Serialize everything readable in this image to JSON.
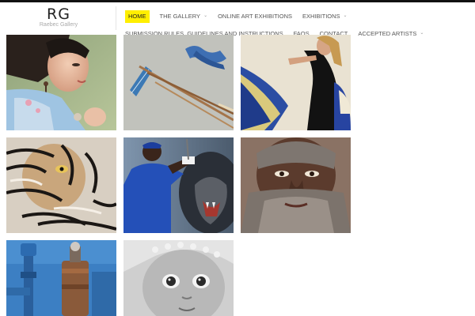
{
  "logo": {
    "mark": "RG",
    "subtitle": "Raebec Gallery"
  },
  "nav": {
    "row1": [
      {
        "label": "HOME",
        "active": true,
        "dropdown": false
      },
      {
        "label": "THE GALLERY",
        "active": false,
        "dropdown": true
      },
      {
        "label": "ONLINE ART EXHIBITIONS",
        "active": false,
        "dropdown": false
      },
      {
        "label": "EXHIBITIONS",
        "active": false,
        "dropdown": true
      }
    ],
    "row2": [
      {
        "label": "SUBMISSION RULES, GUIDELINES AND INSTRUCTIONS",
        "active": false,
        "dropdown": false
      },
      {
        "label": "FAQS",
        "active": false,
        "dropdown": false
      },
      {
        "label": "CONTACT",
        "active": false,
        "dropdown": false
      },
      {
        "label": "ACCEPTED ARTISTS",
        "active": false,
        "dropdown": true
      }
    ],
    "dropdown_icon": "chevron-down-icon"
  },
  "gallery": {
    "artworks": [
      "woman-with-earring-painting",
      "pencils-and-ribbon-drawing",
      "dancer-with-blue-fabric-painting",
      "tiger-painting",
      "golfer-and-tiger-painting",
      "bearded-man-portrait-painting",
      "blue-pipes-still-life-painting",
      "baby-portrait-drawing"
    ]
  },
  "colors": {
    "active_nav": "#ffef00",
    "topbar": "#111111"
  }
}
